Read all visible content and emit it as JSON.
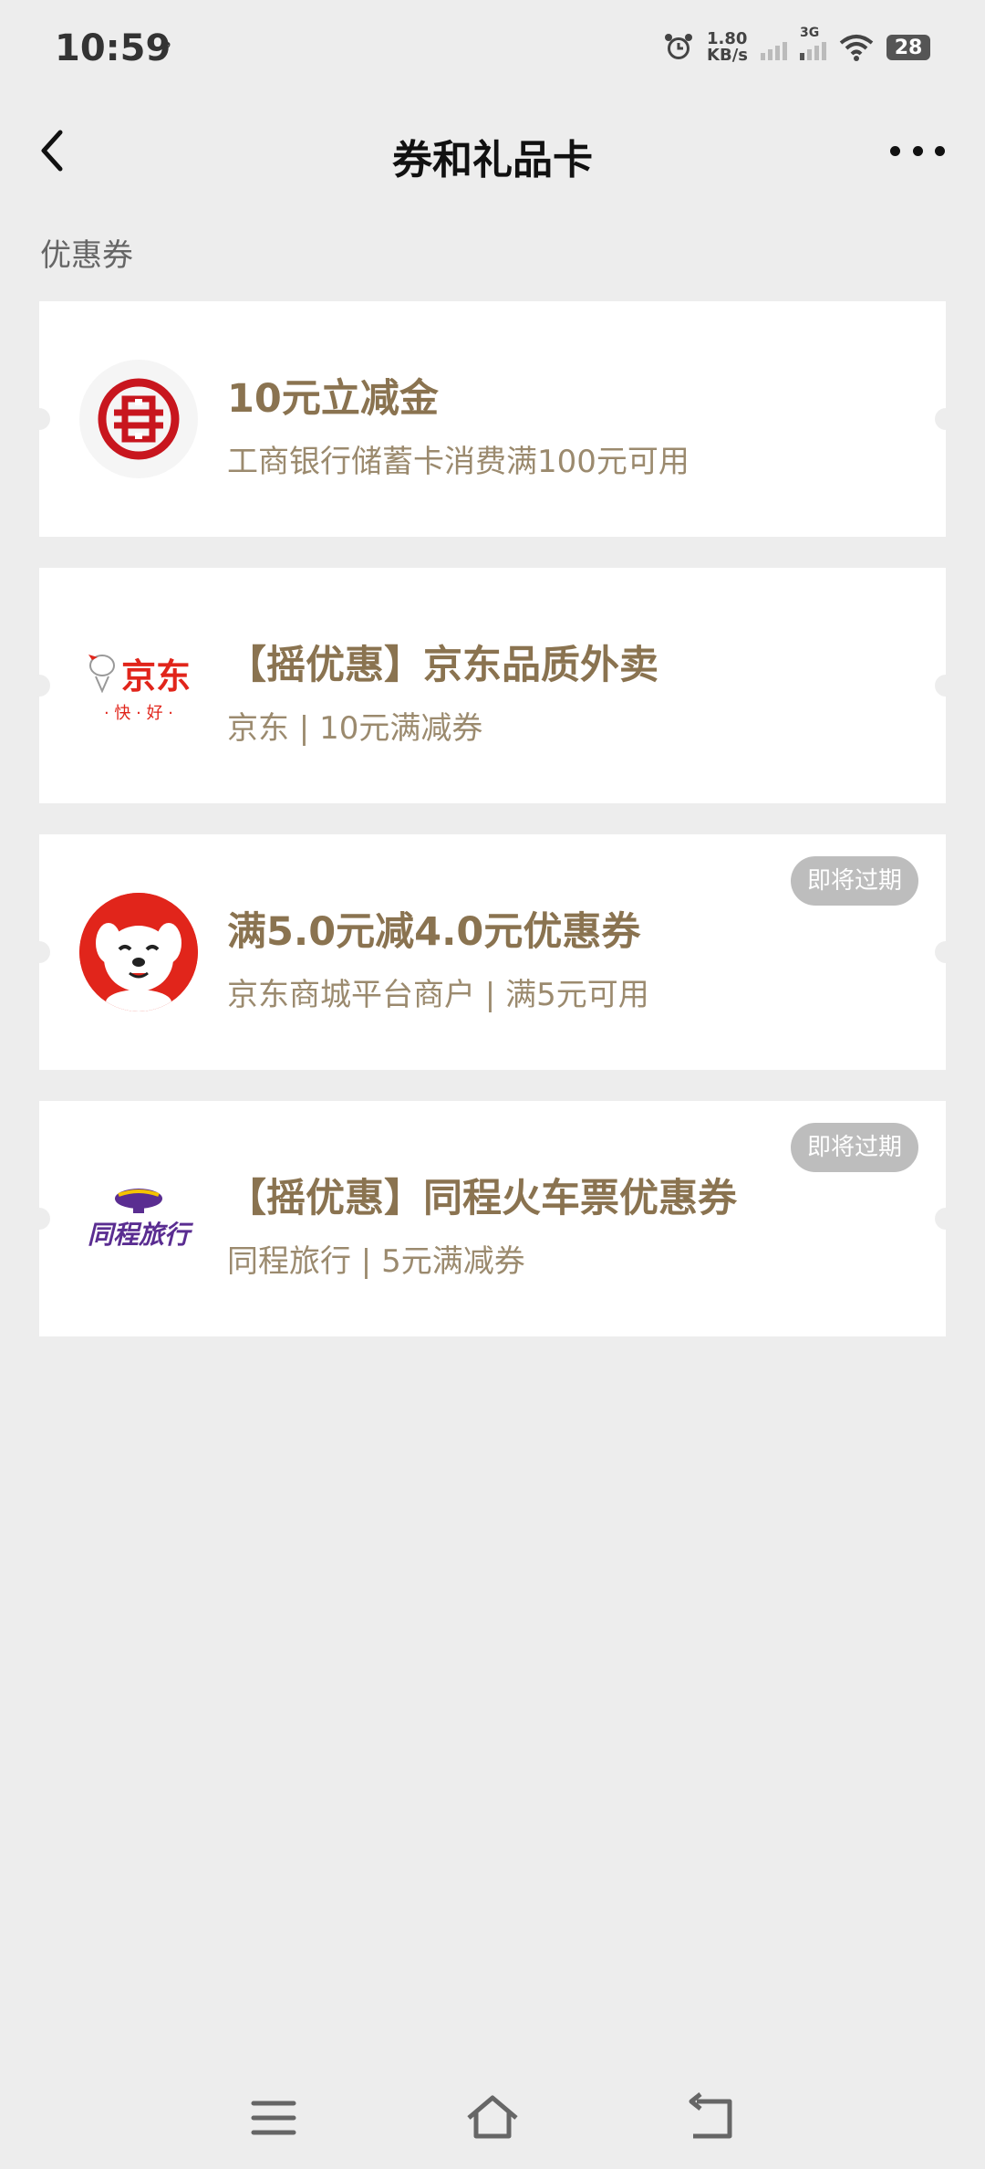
{
  "status": {
    "time": "10:59",
    "net_speed_value": "1.80",
    "net_speed_unit": "KB/s",
    "network": "3G",
    "battery": "28"
  },
  "nav": {
    "title": "券和礼品卡"
  },
  "section_title": "优惠券",
  "cards": [
    {
      "title": "10元立减金",
      "subtitle": "工商银行储蓄卡消费满100元可用",
      "badge": ""
    },
    {
      "title": "【摇优惠】京东品质外卖",
      "subtitle": "京东 | 10元满减券",
      "badge": "",
      "logo_text_main": "京东",
      "logo_text_sub": "· 快 · 好 ·"
    },
    {
      "title": "满5.0元减4.0元优惠券",
      "subtitle": "京东商城平台商户 | 满5元可用",
      "badge": "即将过期"
    },
    {
      "title": "【摇优惠】同程火车票优惠券",
      "subtitle": "同程旅行 | 5元满减券",
      "badge": "即将过期",
      "logo_text_main": "同程旅行"
    }
  ],
  "colors": {
    "accent": "#8a7350",
    "icbc_red": "#c8161e",
    "jd_red": "#e1251b",
    "tongcheng_purple": "#5a2d91"
  }
}
